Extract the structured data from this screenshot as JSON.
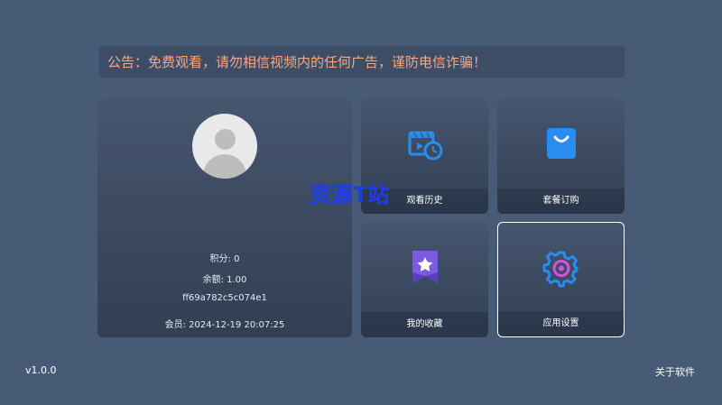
{
  "notice": {
    "text": "公告：免费观看，请勿相信视频内的任何广告，谨防电信诈骗！"
  },
  "profile": {
    "points": "积分: 0",
    "balance": "余额: 1.00",
    "device_id": "ff69a782c5c074e1",
    "member": "会员: 2024-12-19 20:07:25"
  },
  "tiles": [
    {
      "label": "观看历史",
      "icon": "history-icon"
    },
    {
      "label": "套餐订购",
      "icon": "shopping-bag-icon"
    },
    {
      "label": "我的收藏",
      "icon": "bookmark-star-icon"
    },
    {
      "label": "应用设置",
      "icon": "gear-icon"
    }
  ],
  "watermark": "资源T站",
  "footer": {
    "version": "v1.0.0",
    "about": "关于软件"
  },
  "colors": {
    "background": "#475b76",
    "notice_text": "#f2a98a",
    "accent_blue": "#2b8cf0",
    "watermark": "#1c3cf0"
  }
}
